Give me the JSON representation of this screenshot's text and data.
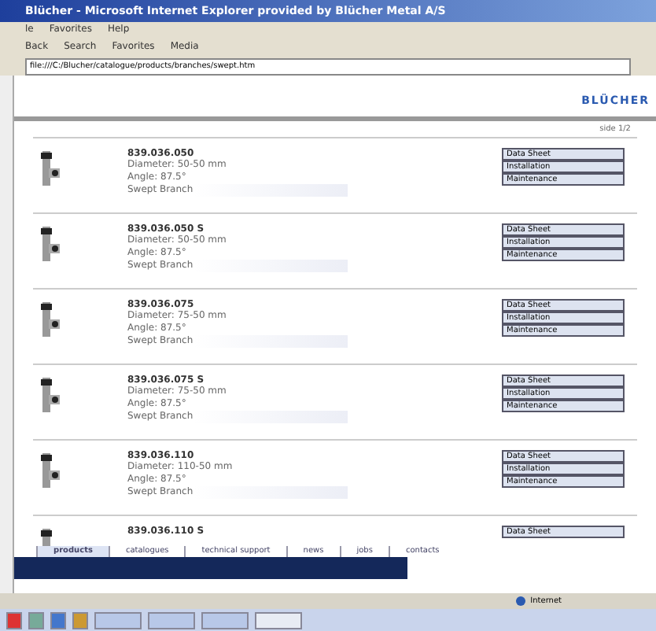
{
  "window": {
    "title": "Blücher - Microsoft Internet Explorer provided by Blücher Metal A/S"
  },
  "menu": [
    "le",
    "Favorites",
    "Help"
  ],
  "toolbar": [
    "Back",
    "Search",
    "Favorites",
    "Media"
  ],
  "address": {
    "value": "file:///C:/Blucher/catalogue/products/branches/swept.htm"
  },
  "logo": "BLÜCHER",
  "page_indicator": "side 1/2",
  "products": [
    {
      "code": "839.036.050",
      "lines": [
        "Diameter: 50-50 mm",
        "Angle: 87.5°",
        "Swept Branch"
      ],
      "buttons": [
        "Data Sheet",
        "Installation",
        "Maintenance"
      ]
    },
    {
      "code": "839.036.050 S",
      "lines": [
        "Diameter: 50-50 mm",
        "Angle: 87.5°",
        "Swept Branch"
      ],
      "buttons": [
        "Data Sheet",
        "Installation",
        "Maintenance"
      ]
    },
    {
      "code": "839.036.075",
      "lines": [
        "Diameter: 75-50 mm",
        "Angle: 87.5°",
        "Swept Branch"
      ],
      "buttons": [
        "Data Sheet",
        "Installation",
        "Maintenance"
      ]
    },
    {
      "code": "839.036.075 S",
      "lines": [
        "Diameter: 75-50 mm",
        "Angle: 87.5°",
        "Swept Branch"
      ],
      "buttons": [
        "Data Sheet",
        "Installation",
        "Maintenance"
      ]
    },
    {
      "code": "839.036.110",
      "lines": [
        "Diameter: 110-50 mm",
        "Angle: 87.5°",
        "Swept Branch"
      ],
      "buttons": [
        "Data Sheet",
        "Installation",
        "Maintenance"
      ]
    },
    {
      "code": "839.036.110 S",
      "buttons": [
        "Data Sheet"
      ]
    }
  ],
  "tabs": [
    {
      "label": "products",
      "selected": true
    },
    {
      "label": "catalogues",
      "selected": false
    },
    {
      "label": "technical support",
      "selected": false
    },
    {
      "label": "news",
      "selected": false
    },
    {
      "label": "jobs",
      "selected": false
    },
    {
      "label": "contacts",
      "selected": false
    }
  ],
  "status_bar": {
    "zone": "Internet"
  }
}
